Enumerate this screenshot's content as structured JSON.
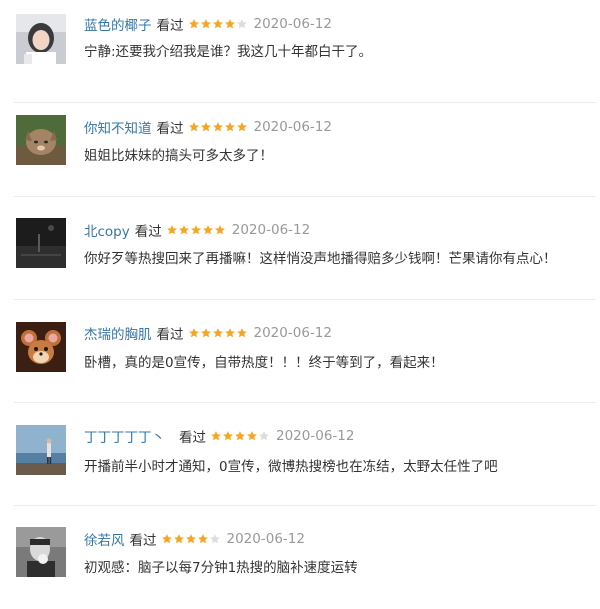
{
  "colors": {
    "username": "#3377aa",
    "star_on": "#f6a623",
    "star_off": "#dddddd",
    "date": "#999999",
    "text": "#333333"
  },
  "comments": [
    {
      "user": "蓝色的椰子",
      "status": "看过",
      "stars": 4,
      "date": "2020-06-12",
      "text": "宁静:还要我介绍我是谁？我这几十年都白干了。",
      "avatar": "girl-photo"
    },
    {
      "user": "你知不知道",
      "status": "看过",
      "stars": 5,
      "date": "2020-06-12",
      "text": "姐姐比妹妹的搞头可多太多了！",
      "avatar": "cat-photo"
    },
    {
      "user": "北copy",
      "status": "看过",
      "stars": 5,
      "date": "2020-06-12",
      "text": "你好歹等热搜回来了再播嘛！这样悄没声地播得赔多少钱啊！芒果请你有点心！",
      "avatar": "dark-photo"
    },
    {
      "user": "杰瑞的胸肌",
      "status": "看过",
      "stars": 5,
      "date": "2020-06-12",
      "text": "卧槽，真的是0宣传，自带热度！！！终于等到了，看起来！",
      "avatar": "cartoon-mouse"
    },
    {
      "user": "丁丁丁丁丁丶",
      "status": "看过",
      "stars": 4,
      "date": "2020-06-12",
      "text": "开播前半小时才通知，0宣传，微博热搜榜也在冻结，太野太任性了吧",
      "avatar": "sea-photo"
    },
    {
      "user": "徐若风",
      "status": "看过",
      "stars": 4,
      "date": "2020-06-12",
      "text": "初观感：脑子以每7分钟1热搜的脑补速度运转",
      "avatar": "bw-boy-photo"
    }
  ]
}
